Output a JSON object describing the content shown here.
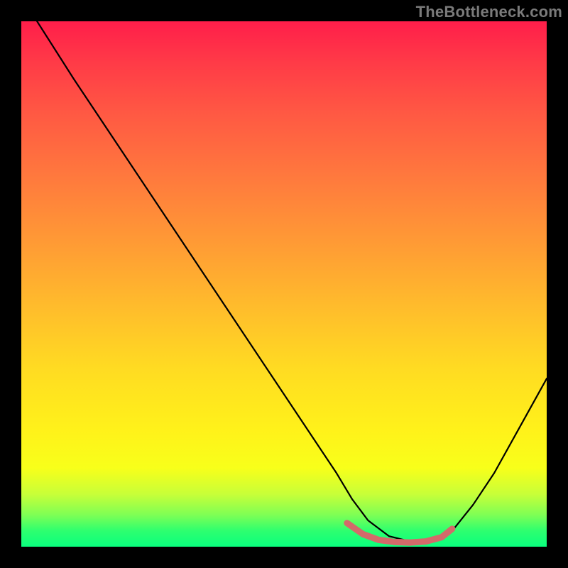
{
  "watermark": "TheBottleneck.com",
  "chart_data": {
    "type": "line",
    "title": "",
    "xlabel": "",
    "ylabel": "",
    "xlim": [
      0,
      100
    ],
    "ylim": [
      0,
      100
    ],
    "series": [
      {
        "name": "bottleneck-curve",
        "color": "#000000",
        "x": [
          3,
          10,
          20,
          30,
          40,
          50,
          56,
          60,
          63,
          66,
          70,
          74,
          78,
          82,
          86,
          90,
          95,
          100
        ],
        "y": [
          100,
          89,
          74,
          59,
          44,
          29,
          20,
          14,
          9,
          5,
          2,
          1,
          1,
          3,
          8,
          14,
          23,
          32
        ]
      },
      {
        "name": "optimal-range",
        "color": "#d36a6a",
        "x": [
          62,
          65,
          68,
          71,
          74,
          77,
          80,
          82
        ],
        "y": [
          4.5,
          2.4,
          1.3,
          0.9,
          0.8,
          1.0,
          1.8,
          3.4
        ]
      }
    ],
    "gradient_stops": [
      {
        "pos": 0,
        "color": "#ff1e4a"
      },
      {
        "pos": 8,
        "color": "#ff3b47"
      },
      {
        "pos": 18,
        "color": "#ff5a43"
      },
      {
        "pos": 30,
        "color": "#ff7a3d"
      },
      {
        "pos": 42,
        "color": "#ff9a35"
      },
      {
        "pos": 54,
        "color": "#ffbb2c"
      },
      {
        "pos": 66,
        "color": "#ffdb22"
      },
      {
        "pos": 78,
        "color": "#fff21a"
      },
      {
        "pos": 85,
        "color": "#f8ff1a"
      },
      {
        "pos": 90,
        "color": "#c8ff38"
      },
      {
        "pos": 94,
        "color": "#7dff55"
      },
      {
        "pos": 97,
        "color": "#2dff6f"
      },
      {
        "pos": 100,
        "color": "#0aff7e"
      }
    ]
  }
}
